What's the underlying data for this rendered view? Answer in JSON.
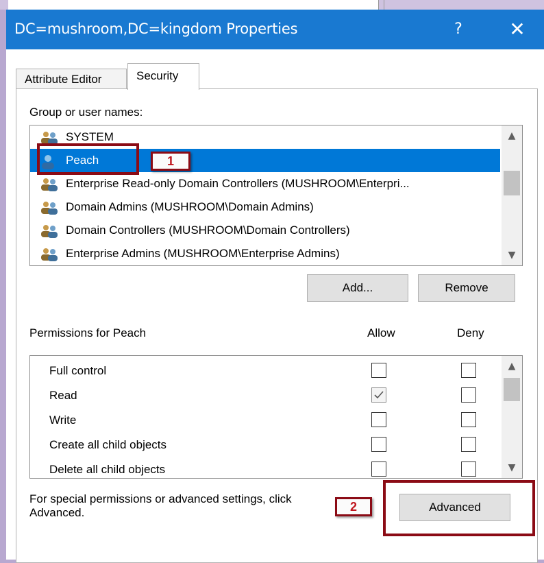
{
  "window": {
    "title": "DC=mushroom,DC=kingdom Properties",
    "help_glyph": "?",
    "close_glyph": "✕"
  },
  "tabs": [
    {
      "label": "Attribute Editor",
      "selected": false
    },
    {
      "label": "Security",
      "selected": true
    }
  ],
  "group_section": {
    "label": "Group or user names:",
    "items": [
      {
        "name": "SYSTEM",
        "icon": "group-icon",
        "selected": false
      },
      {
        "name": "Peach",
        "icon": "user-icon",
        "selected": true
      },
      {
        "name": "Enterprise Read-only Domain Controllers (MUSHROOM\\Enterpri...",
        "icon": "group-icon",
        "selected": false
      },
      {
        "name": "Domain Admins (MUSHROOM\\Domain Admins)",
        "icon": "group-icon",
        "selected": false
      },
      {
        "name": "Domain Controllers (MUSHROOM\\Domain Controllers)",
        "icon": "group-icon",
        "selected": false
      },
      {
        "name": "Enterprise Admins (MUSHROOM\\Enterprise Admins)",
        "icon": "group-icon",
        "selected": false
      }
    ],
    "add_label": "Add...",
    "remove_label": "Remove"
  },
  "permissions": {
    "label": "Permissions for Peach",
    "allow_header": "Allow",
    "deny_header": "Deny",
    "rows": [
      {
        "name": "Full control",
        "allow": false,
        "deny": false
      },
      {
        "name": "Read",
        "allow": true,
        "deny": false
      },
      {
        "name": "Write",
        "allow": false,
        "deny": false
      },
      {
        "name": "Create all child objects",
        "allow": false,
        "deny": false
      },
      {
        "name": "Delete all child objects",
        "allow": false,
        "deny": false
      }
    ]
  },
  "special": {
    "line1": "For special permissions or advanced settings, click",
    "line2": "Advanced.",
    "advanced_label": "Advanced"
  },
  "annotations": {
    "badge1": "1",
    "badge2": "2",
    "color": "#8b0b15"
  },
  "colors": {
    "titlebar": "#1979d1",
    "selection": "#0078d7",
    "annotation": "#8b0b15"
  }
}
